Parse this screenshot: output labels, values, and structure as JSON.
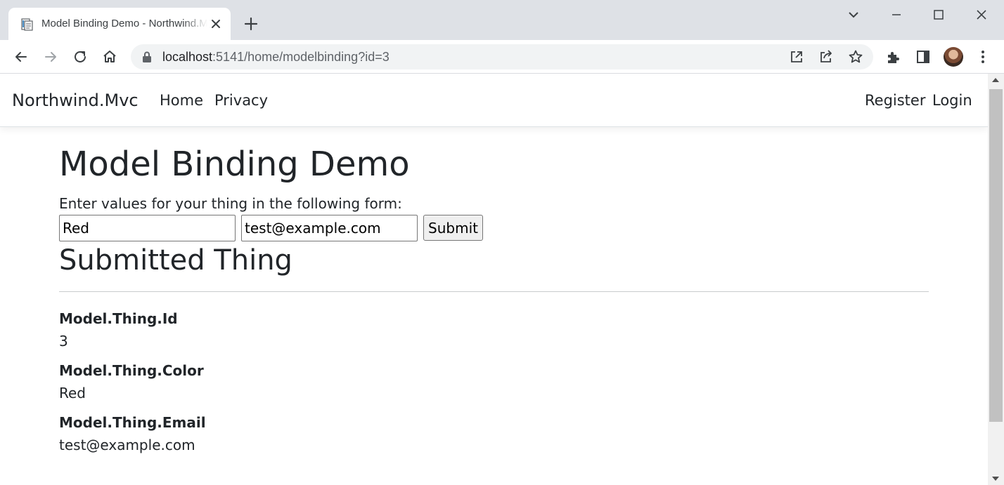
{
  "browser": {
    "tab_title": "Model Binding Demo - Northwind.Mvc",
    "url_host": "localhost",
    "url_rest": ":5141/home/modelbinding?id=3"
  },
  "navbar": {
    "brand": "Northwind.Mvc",
    "links": [
      "Home",
      "Privacy"
    ],
    "right_links": [
      "Register",
      "Login"
    ]
  },
  "page": {
    "heading": "Model Binding Demo",
    "instructions": "Enter values for your thing in the following form:",
    "form": {
      "color_value": "Red",
      "email_value": "test@example.com",
      "submit_label": "Submit"
    },
    "submitted_heading": "Submitted Thing",
    "details": [
      {
        "label": "Model.Thing.Id",
        "value": "3"
      },
      {
        "label": "Model.Thing.Color",
        "value": "Red"
      },
      {
        "label": "Model.Thing.Email",
        "value": "test@example.com"
      }
    ]
  },
  "colors": {
    "tabstrip": "#dee1e6",
    "text": "#212529",
    "omnibox": "#f1f3f4"
  }
}
